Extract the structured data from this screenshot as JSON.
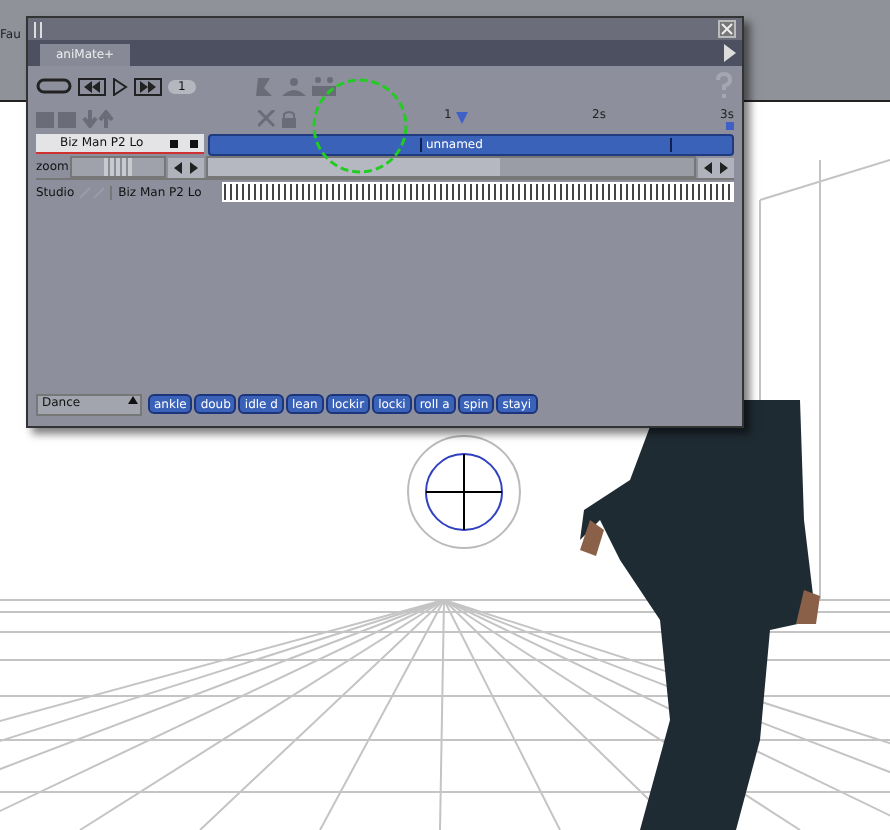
{
  "background_menu": {
    "label": "Fau"
  },
  "palette": {
    "tab": {
      "label": "aniMate+",
      "selected": true
    },
    "frame_field": {
      "value": "1"
    },
    "ruler": {
      "marks": [
        "1",
        "2s",
        "3s"
      ]
    },
    "track": {
      "name": "Biz Man P2 Lo",
      "clips": [
        "unnamed"
      ]
    },
    "zoom": {
      "label": "zoom",
      "level": 0.5
    },
    "studio": {
      "label": "Studio",
      "figure": "Biz Man P2 Lo"
    },
    "library": {
      "category": "Dance",
      "clips": [
        "ankle",
        "doub",
        "idle d",
        "lean",
        "lockir",
        "locki",
        "roll a",
        "spin",
        "stayi"
      ]
    }
  }
}
